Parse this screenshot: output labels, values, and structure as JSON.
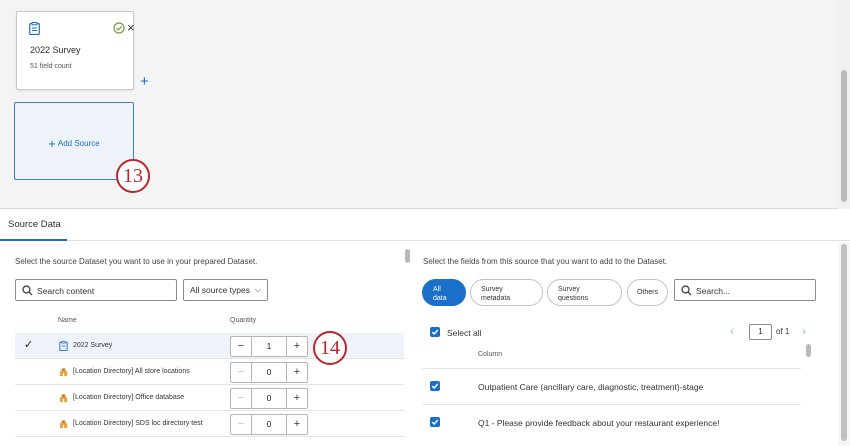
{
  "canvas": {
    "source_card": {
      "title": "2022 Survey",
      "subtitle": "51 field count",
      "close_symbol": "×"
    },
    "add_source_label": "Add Source",
    "callouts": [
      "13",
      "14"
    ]
  },
  "panel": {
    "tab_label": "Source Data"
  },
  "left": {
    "instruction": "Select the source Dataset you want to use in your prepared Dataset.",
    "search_placeholder": "Search content",
    "source_type_select": "All source types",
    "col_name": "Name",
    "col_quantity": "Quantity",
    "rows": [
      {
        "name": "2022 Survey",
        "quantity": "1",
        "selected": true,
        "icon": "clipboard-icon"
      },
      {
        "name": "[Location Directory] All store locations",
        "quantity": "0",
        "selected": false,
        "icon": "location-directory-icon"
      },
      {
        "name": "[Location Directory] Office database",
        "quantity": "0",
        "selected": false,
        "icon": "location-directory-icon"
      },
      {
        "name": "[Location Directory] SDS loc directory test",
        "quantity": "0",
        "selected": false,
        "icon": "location-directory-icon"
      }
    ]
  },
  "right": {
    "instruction": "Select the fields from this source that you want to add to the Dataset.",
    "filters": [
      {
        "label_line1": "All",
        "label_line2": "data"
      },
      {
        "label_line1": "Survey",
        "label_line2": "metadata"
      },
      {
        "label_line1": "Survey",
        "label_line2": "questions"
      },
      {
        "label": "Others"
      }
    ],
    "search_placeholder": "Search...",
    "select_all_label": "Select all",
    "pager": {
      "current": "1",
      "of_label": "of 1"
    },
    "column_header": "Column",
    "fields": [
      "Outpatient Care (ancillary care, diagnostic, treatment)-stage",
      "Q1 - Please provide feedback about your restaurant experience!"
    ]
  },
  "colors": {
    "accent": "#1a6fc9",
    "callout": "#b8282d",
    "success": "#2e8540"
  }
}
